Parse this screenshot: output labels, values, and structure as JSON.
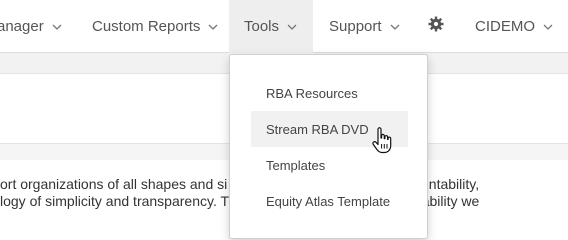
{
  "navbar": {
    "items": [
      {
        "label": "anager"
      },
      {
        "label": "Custom Reports"
      },
      {
        "label": "Tools"
      },
      {
        "label": "Support"
      },
      {
        "label": "CIDEMO"
      }
    ]
  },
  "dropdown": {
    "items": [
      {
        "label": "RBA Resources"
      },
      {
        "label": "Stream RBA DVD"
      },
      {
        "label": "Templates"
      },
      {
        "label": "Equity Atlas Template"
      }
    ]
  },
  "content": {
    "line1": "ort organizations of all shapes and si                              hrough accountability,",
    "line2": "logy of simplicity and transparency. T                              sed Accountability we"
  },
  "icons": {
    "settings": "gear-icon",
    "dropdown_arrow": "chevron-down-icon",
    "pointer": "hand-pointer-cursor"
  }
}
